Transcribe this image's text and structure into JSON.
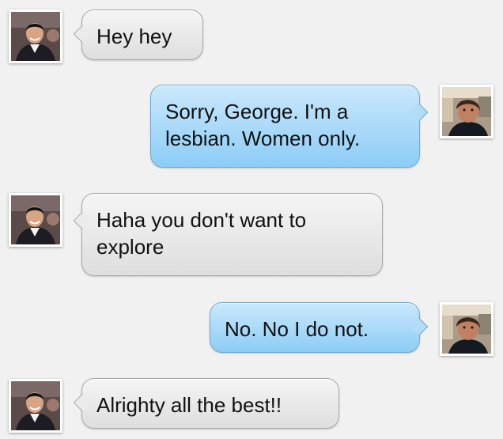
{
  "conversation": {
    "messages": [
      {
        "sender": "George",
        "direction": "incoming",
        "text": "Hey hey"
      },
      {
        "sender": "Me",
        "direction": "outgoing",
        "text": "Sorry, George. I'm a lesbian. Women only."
      },
      {
        "sender": "George",
        "direction": "incoming",
        "text": "Haha you don't want to explore"
      },
      {
        "sender": "Me",
        "direction": "outgoing",
        "text": "No. No I do not."
      },
      {
        "sender": "George",
        "direction": "incoming",
        "text": "Alrighty all the best!!"
      }
    ]
  },
  "colors": {
    "background": "#f1f1f1",
    "incoming_bubble": "#e6e6e6",
    "outgoing_bubble": "#a9dbfb"
  },
  "icons": {
    "contact_avatar": "contact-avatar-icon",
    "own_avatar": "user-avatar-icon"
  }
}
